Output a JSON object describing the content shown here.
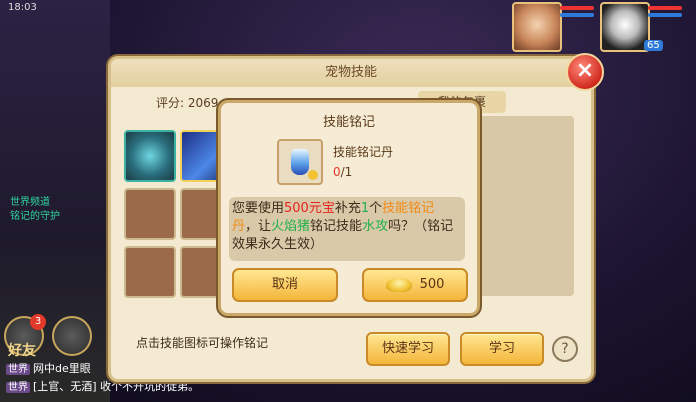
{
  "status": {
    "time": "18:03"
  },
  "colors": {
    "accent": "#f4b53a",
    "panel_bg": "#f4ead2",
    "highlight_red": "#e8231c",
    "highlight_green": "#22b14c",
    "highlight_orange": "#f28a12"
  },
  "top_right": {
    "level_badge": "65"
  },
  "panel": {
    "title": "宠物技能",
    "score_label": "评分: 2069",
    "tab_pack": "我的包裹",
    "hint": "点击技能图标可操作铭记",
    "quick_learn": "快速学习",
    "learn": "学习",
    "help": "?",
    "close": "×"
  },
  "left": {
    "friend_label": "好友",
    "badge_count": "3",
    "side_text": [
      "世界频道",
      "铭记的守护"
    ],
    "chat": [
      {
        "tag": "世界",
        "text": "网中de里眼"
      },
      {
        "tag": "世界",
        "text": "[上官、无酒] 收个不开坑的徒弟。"
      }
    ]
  },
  "modal": {
    "title": "技能铭记",
    "item_name": "技能铭记丹",
    "count_have": "0",
    "count_need": "/1",
    "msg_prefix": "您要使用",
    "msg_cost": "500元宝",
    "msg_mid1": "补充",
    "msg_qty": "1",
    "msg_mid2": "个",
    "msg_item": "技能铭记丹",
    "msg_mid3": "，让",
    "msg_pet": "火焰猪",
    "msg_mid4": "铭记技能",
    "msg_skill": "水攻",
    "msg_suffix": "吗？（铭记效果永久生效）",
    "cancel": "取消",
    "pay_amount": "500"
  }
}
